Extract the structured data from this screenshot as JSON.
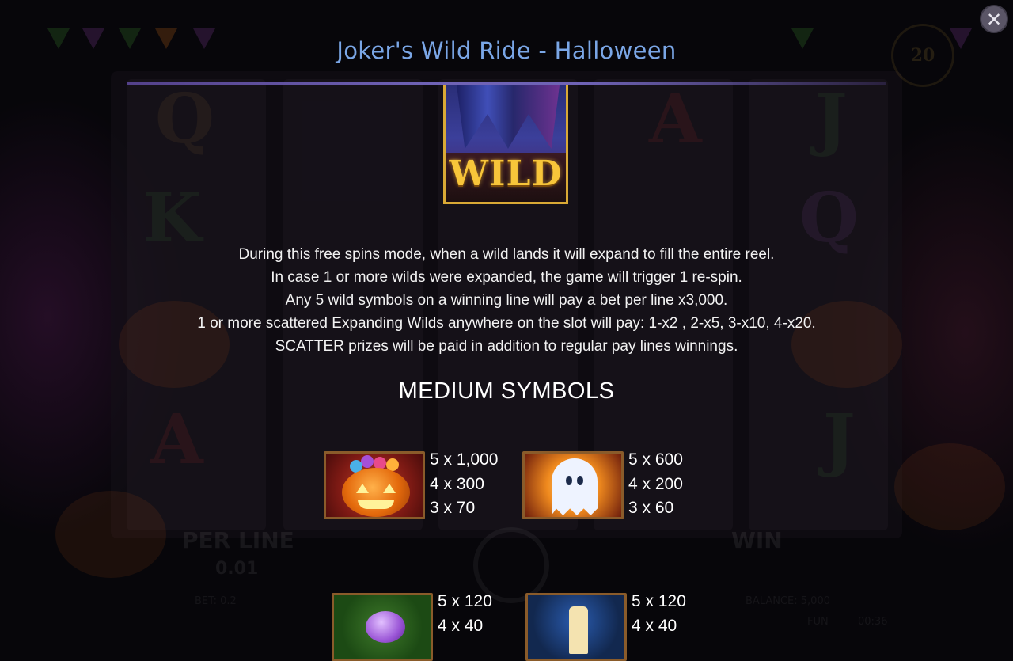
{
  "title": "Joker's Wild Ride - Halloween",
  "close_label": "✕",
  "wild_label": "WILD",
  "rules": [
    "During this free spins mode, when a wild lands it will expand to fill the entire reel.",
    "In case 1 or more wilds were expanded, the game will trigger 1 re-spin.",
    "Any 5 wild symbols on a winning line will pay a bet per line x3,000.",
    "1 or more scattered Expanding Wilds anywhere on the slot will pay: 1-x2 , 2-x5, 3-x10, 4-x20.",
    "SCATTER prizes will be paid in addition to regular pay lines winnings."
  ],
  "section_title": "MEDIUM SYMBOLS",
  "symbols": [
    {
      "icon": "pumpkin-icon",
      "pays": [
        "5 x 1,000",
        "4 x 300",
        "3 x 70"
      ]
    },
    {
      "icon": "ghost-icon",
      "pays": [
        "5 x 600",
        "4 x 200",
        "3 x 60"
      ]
    },
    {
      "icon": "spider-icon",
      "pays": [
        "5 x 120",
        "4 x 40"
      ]
    },
    {
      "icon": "candle-icon",
      "pays": [
        "5 x 120",
        "4 x 40"
      ]
    }
  ],
  "background": {
    "per_line_label": "PER LINE",
    "per_line_value": "0.01",
    "win_label": "WIN",
    "bet_text": "BET: 0.2",
    "balance_text": "BALANCE: 5,000",
    "fun_text": "FUN",
    "time_text": "00:36",
    "counter_value": "20"
  },
  "colors": {
    "title": "#7aa6e6",
    "title_rule": "#6f63b6",
    "wild_gold": "#f7c53a",
    "tile_border": "#8a5b2a",
    "close_bg": "#5a5566"
  }
}
